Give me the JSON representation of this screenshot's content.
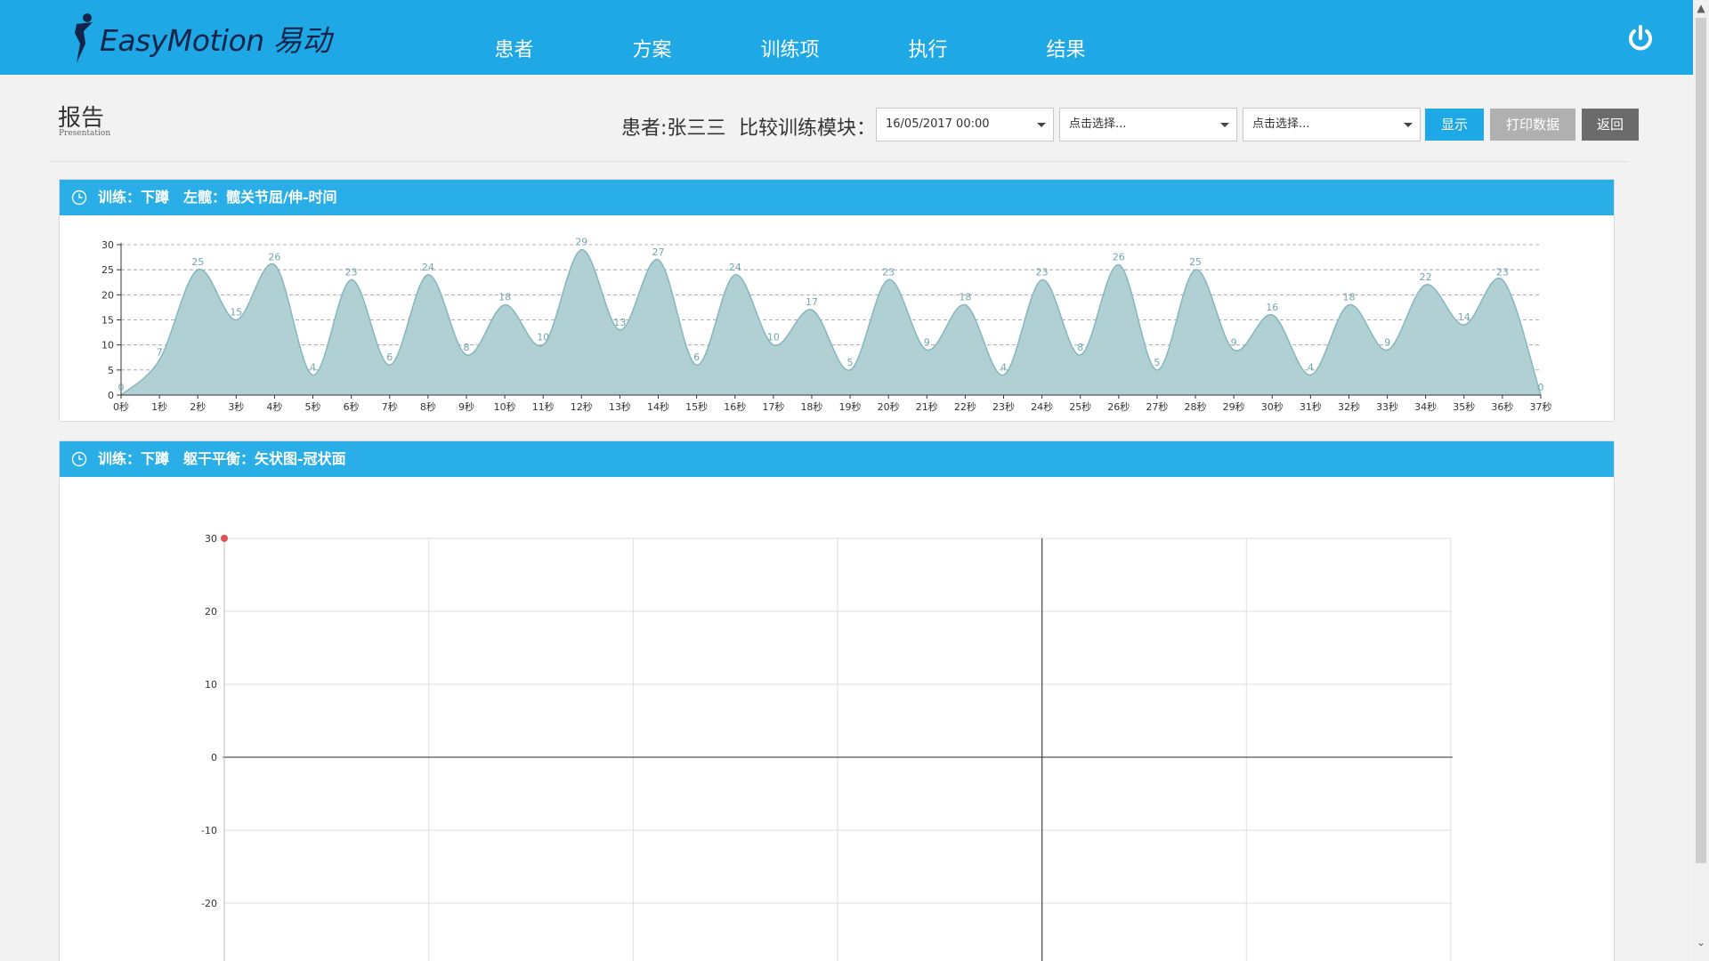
{
  "header": {
    "brand_text": "EasyMotion 易动",
    "nav": [
      {
        "label": "患者"
      },
      {
        "label": "方案"
      },
      {
        "label": "训练项"
      },
      {
        "label": "执行"
      },
      {
        "label": "结果"
      }
    ],
    "icons": {
      "power": "power-icon"
    },
    "colors": {
      "header_bg": "#1ea8e5",
      "panel_head": "#29aee8",
      "area_fill": "#b1d0d4",
      "area_line": "#84b6bd"
    }
  },
  "page": {
    "title": "报告",
    "subtitle": "Presentation",
    "patient_label": "患者:张三三",
    "compare_label": "比较训练模块："
  },
  "controls": {
    "date_select": "16/05/2017 00:00",
    "select_2": "点击选择...",
    "select_3": "点击选择...",
    "show_label": "显示",
    "print_label": "打印数据",
    "back_label": "返回"
  },
  "panels": [
    {
      "title": "训练：下蹲　左髋：髋关节屈/伸-时间"
    },
    {
      "title": "训练：下蹲　躯干平衡：矢状图-冠状面"
    }
  ],
  "chart_data": [
    {
      "type": "area",
      "x": [
        "0秒",
        "1秒",
        "2秒",
        "3秒",
        "4秒",
        "5秒",
        "6秒",
        "7秒",
        "8秒",
        "9秒",
        "10秒",
        "11秒",
        "12秒",
        "13秒",
        "14秒",
        "15秒",
        "16秒",
        "17秒",
        "18秒",
        "19秒",
        "20秒",
        "21秒",
        "22秒",
        "23秒",
        "24秒",
        "25秒",
        "26秒",
        "27秒",
        "28秒",
        "29秒",
        "30秒",
        "31秒",
        "32秒",
        "33秒",
        "34秒",
        "35秒",
        "36秒",
        "37秒"
      ],
      "values": [
        0,
        7,
        25,
        15,
        26,
        4,
        23,
        6,
        24,
        8,
        18,
        10,
        29,
        13,
        27,
        6,
        24,
        10,
        17,
        5,
        23,
        9,
        18,
        4,
        23,
        8,
        26,
        5,
        25,
        9,
        16,
        4,
        18,
        9,
        22,
        14,
        23,
        0
      ],
      "yticks": [
        0,
        5,
        10,
        15,
        20,
        25,
        30
      ],
      "ylim": [
        0,
        30
      ],
      "grid": "dashed-horizontal"
    },
    {
      "type": "scatter",
      "points": [
        {
          "x": -4,
          "y": 30
        }
      ],
      "xlim": [
        -4,
        2
      ],
      "yticks": [
        30,
        20,
        10,
        0,
        -10,
        -20
      ],
      "ylim": [
        -30,
        30
      ],
      "grid": true,
      "point_color": "#d9534f"
    }
  ]
}
